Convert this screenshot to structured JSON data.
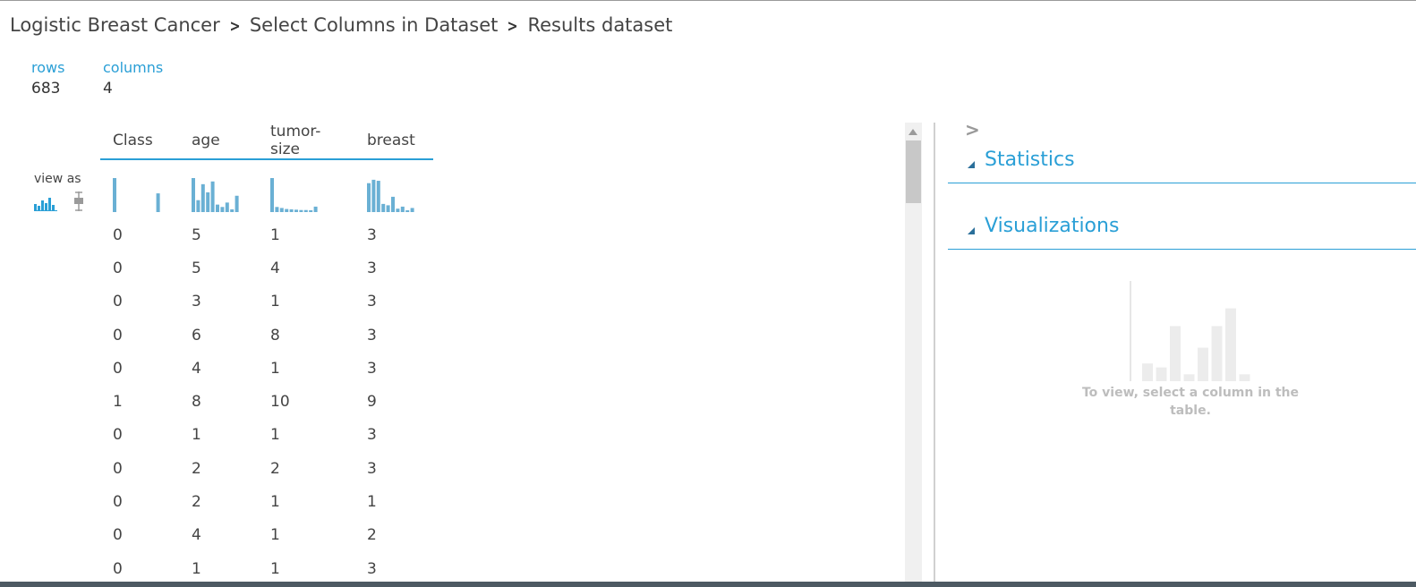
{
  "breadcrumb": [
    "Logistic Breast Cancer",
    "Select Columns in Dataset",
    "Results dataset"
  ],
  "summary": {
    "rows_label": "rows",
    "rows_value": "683",
    "columns_label": "columns",
    "columns_value": "4"
  },
  "view_as": {
    "label": "view as",
    "options": [
      "histogram-icon",
      "boxplot-icon"
    ]
  },
  "table": {
    "columns": [
      "Class",
      "age",
      "tumor-size",
      "breast"
    ],
    "rows": [
      [
        "0",
        "5",
        "1",
        "3"
      ],
      [
        "0",
        "5",
        "4",
        "3"
      ],
      [
        "0",
        "3",
        "1",
        "3"
      ],
      [
        "0",
        "6",
        "8",
        "3"
      ],
      [
        "0",
        "4",
        "1",
        "3"
      ],
      [
        "1",
        "8",
        "10",
        "9"
      ],
      [
        "0",
        "1",
        "1",
        "3"
      ],
      [
        "0",
        "2",
        "2",
        "3"
      ],
      [
        "0",
        "2",
        "1",
        "1"
      ],
      [
        "0",
        "4",
        "1",
        "2"
      ],
      [
        "0",
        "1",
        "1",
        "3"
      ]
    ],
    "histograms": [
      [
        1.0,
        0,
        0,
        0,
        0,
        0,
        0,
        0,
        0,
        0.55
      ],
      [
        1.0,
        0.35,
        0.82,
        0.58,
        0.9,
        0.22,
        0.15,
        0.28,
        0.08,
        0.48
      ],
      [
        1.0,
        0.15,
        0.12,
        0.09,
        0.08,
        0.07,
        0.06,
        0.06,
        0.05,
        0.16
      ],
      [
        0.85,
        0.95,
        0.92,
        0.24,
        0.2,
        0.45,
        0.1,
        0.16,
        0.05,
        0.12
      ]
    ]
  },
  "right_panel": {
    "sections": [
      "Statistics",
      "Visualizations"
    ],
    "placeholder_text": "To view, select a column in the table.",
    "placeholder_bars": [
      0.18,
      0.14,
      0.56,
      0.07,
      0.34,
      0.56,
      0.74,
      0.07
    ]
  },
  "colors": {
    "accent": "#2a9fd6",
    "histogram": "#6ab0d4",
    "placeholder_bar": "#ececec"
  }
}
